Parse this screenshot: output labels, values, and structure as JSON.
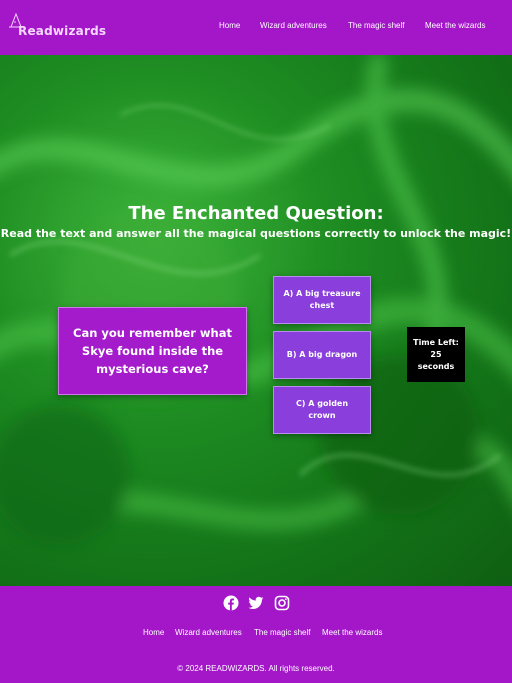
{
  "brand": {
    "name": "Readwizards",
    "logo_color": "#f6d8ff"
  },
  "colors": {
    "header_bg": "#a317c9",
    "question_bg": "#a41bcc",
    "answer_bg": "#8a3fdc",
    "timer_bg": "#000000",
    "hero_green": "#1e8d22"
  },
  "nav": {
    "items": [
      {
        "label": "Home"
      },
      {
        "label": "Wizard adventures"
      },
      {
        "label": "The magic shelf"
      },
      {
        "label": "Meet the wizards"
      }
    ]
  },
  "quiz": {
    "title": "The Enchanted Question:",
    "subtitle": "Read the text and answer all the magical questions correctly to unlock the magic!",
    "question": "Can you remember what Skye found inside the mysterious cave?",
    "answers": [
      {
        "label": "A) A big treasure chest"
      },
      {
        "label": "B) A big dragon"
      },
      {
        "label": "C) A golden crown"
      }
    ],
    "timer": {
      "label": "Time Left:",
      "value": "25",
      "unit": "seconds"
    }
  },
  "footer": {
    "social_icons": [
      "facebook-icon",
      "twitter-icon",
      "instagram-icon"
    ],
    "nav": [
      {
        "label": "Home"
      },
      {
        "label": "Wizard adventures"
      },
      {
        "label": "The magic shelf"
      },
      {
        "label": "Meet the wizards"
      }
    ],
    "copyright": "© 2024 READWIZARDS. All rights reserved."
  }
}
